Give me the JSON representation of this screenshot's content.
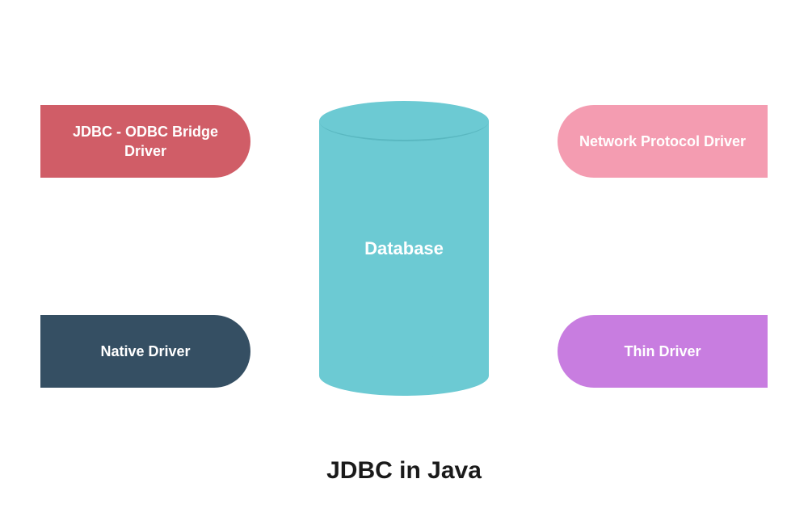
{
  "title": "JDBC in Java",
  "center": {
    "label": "Database"
  },
  "drivers": {
    "top_left": {
      "label": "JDBC - ODBC Bridge Driver",
      "color": "#d05d67"
    },
    "bottom_left": {
      "label": "Native Driver",
      "color": "#354f63"
    },
    "top_right": {
      "label": "Network Protocol Driver",
      "color": "#f49cb1"
    },
    "bottom_right": {
      "label": "Thin Driver",
      "color": "#c87de0"
    }
  }
}
